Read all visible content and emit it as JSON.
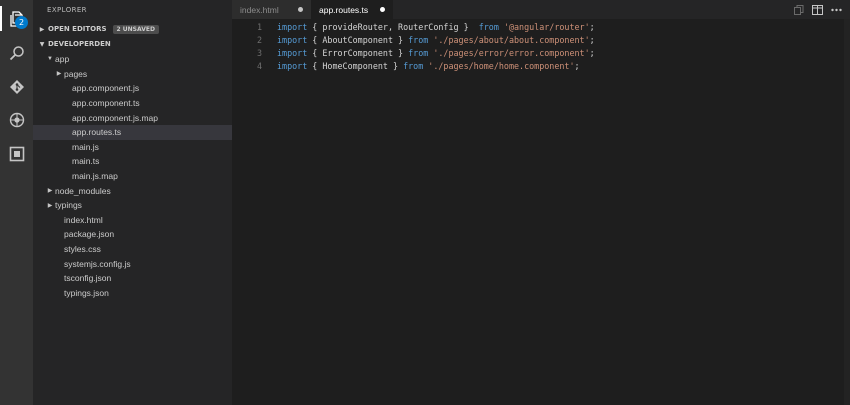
{
  "activity_bar": {
    "items": [
      {
        "name": "explorer-icon",
        "badge": "2"
      },
      {
        "name": "search-icon"
      },
      {
        "name": "source-control-icon"
      },
      {
        "name": "debug-icon"
      },
      {
        "name": "extensions-icon"
      }
    ]
  },
  "sidebar": {
    "title": "EXPLORER",
    "open_editors": {
      "label": "OPEN EDITORS",
      "badge": "2 UNSAVED"
    },
    "project": {
      "label": "DEVELOPERDEN"
    },
    "tree": [
      {
        "label": "app",
        "depth": 1,
        "twisty": "open"
      },
      {
        "label": "pages",
        "depth": 2,
        "twisty": "closed"
      },
      {
        "label": "app.component.js",
        "depth": 3
      },
      {
        "label": "app.component.ts",
        "depth": 3
      },
      {
        "label": "app.component.js.map",
        "depth": 3
      },
      {
        "label": "app.routes.ts",
        "depth": 3,
        "selected": true
      },
      {
        "label": "main.js",
        "depth": 3
      },
      {
        "label": "main.ts",
        "depth": 3
      },
      {
        "label": "main.js.map",
        "depth": 3
      },
      {
        "label": "node_modules",
        "depth": 1,
        "twisty": "closed"
      },
      {
        "label": "typings",
        "depth": 1,
        "twisty": "closed"
      },
      {
        "label": "index.html",
        "depth": 2
      },
      {
        "label": "package.json",
        "depth": 2
      },
      {
        "label": "styles.css",
        "depth": 2
      },
      {
        "label": "systemjs.config.js",
        "depth": 2
      },
      {
        "label": "tsconfig.json",
        "depth": 2
      },
      {
        "label": "typings.json",
        "depth": 2
      }
    ]
  },
  "tabs": [
    {
      "label": "index.html",
      "active": false,
      "dirty": true
    },
    {
      "label": "app.routes.ts",
      "active": true,
      "dirty": true
    }
  ],
  "editor": {
    "lines": [
      {
        "num": "1",
        "tokens": [
          {
            "t": "kw",
            "v": "import"
          },
          {
            "t": "id",
            "v": " { provideRouter, RouterConfig }  "
          },
          {
            "t": "kw",
            "v": "from"
          },
          {
            "t": "id",
            "v": " "
          },
          {
            "t": "str",
            "v": "'@angular/router'"
          },
          {
            "t": "id",
            "v": ";"
          }
        ]
      },
      {
        "num": "2",
        "tokens": [
          {
            "t": "kw",
            "v": "import"
          },
          {
            "t": "id",
            "v": " { AboutComponent } "
          },
          {
            "t": "kw",
            "v": "from"
          },
          {
            "t": "id",
            "v": " "
          },
          {
            "t": "str",
            "v": "'./pages/about/about.component'"
          },
          {
            "t": "id",
            "v": ";"
          }
        ]
      },
      {
        "num": "3",
        "tokens": [
          {
            "t": "kw",
            "v": "import"
          },
          {
            "t": "id",
            "v": " { ErrorComponent } "
          },
          {
            "t": "kw",
            "v": "from"
          },
          {
            "t": "id",
            "v": " "
          },
          {
            "t": "str",
            "v": "'./pages/error/error.component'"
          },
          {
            "t": "id",
            "v": ";"
          }
        ]
      },
      {
        "num": "4",
        "tokens": [
          {
            "t": "kw",
            "v": "import"
          },
          {
            "t": "id",
            "v": " { HomeComponent } "
          },
          {
            "t": "kw",
            "v": "from"
          },
          {
            "t": "id",
            "v": " "
          },
          {
            "t": "str",
            "v": "'./pages/home/home.component'"
          },
          {
            "t": "id",
            "v": ";"
          }
        ]
      }
    ]
  },
  "colors": {
    "keyword": "#569cd6",
    "string": "#ce9178",
    "identifier": "#d4d4d4",
    "badge": "#007acc"
  }
}
